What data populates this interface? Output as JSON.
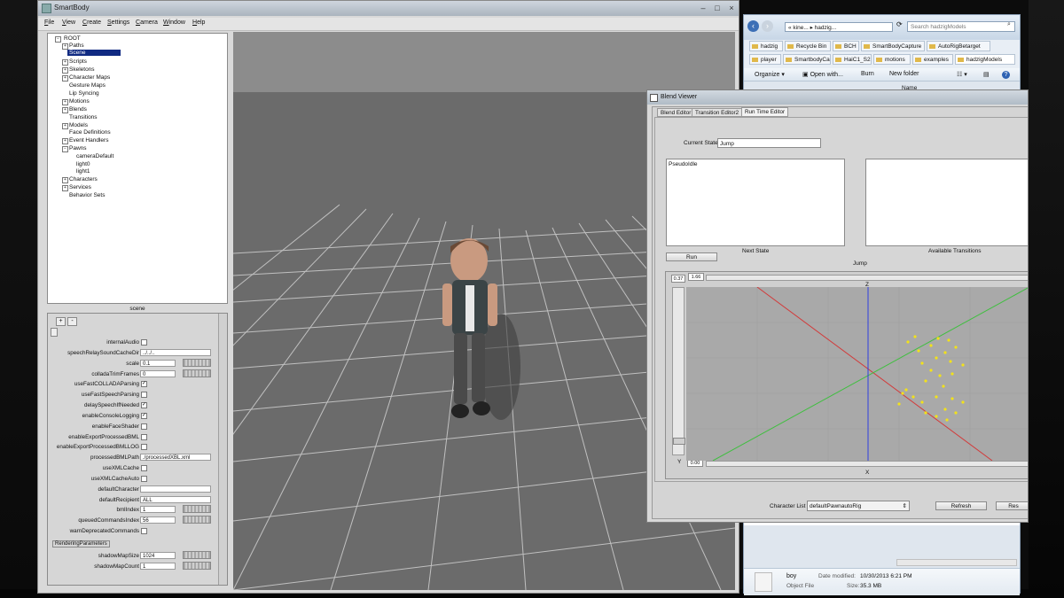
{
  "smartbody": {
    "title": "SmartBody",
    "window_controls": [
      "minimize",
      "maximize",
      "close"
    ],
    "menu": [
      {
        "label": "File",
        "mnemonic": "F",
        "rest": "ile"
      },
      {
        "label": "View",
        "mnemonic": "V",
        "rest": "iew"
      },
      {
        "label": "Create",
        "mnemonic": "C",
        "rest": "reate"
      },
      {
        "label": "Settings",
        "mnemonic": "S",
        "rest": "ettings"
      },
      {
        "label": "Camera",
        "mnemonic": "C",
        "rest": "amera"
      },
      {
        "label": "Window",
        "mnemonic": "W",
        "rest": "indow"
      },
      {
        "label": "Help",
        "mnemonic": "H",
        "rest": "elp"
      }
    ],
    "tree": {
      "root": "ROOT",
      "items": [
        "Paths",
        "Scene",
        "Scripts",
        "Skeletons",
        "Character Maps",
        "Gesture Maps",
        "Lip Syncing",
        "Motions",
        "Blends",
        "Transitions",
        "Models",
        "Face Definitions",
        "Event Handlers",
        "Pawns",
        "cameraDefault",
        "light0",
        "light1",
        "Characters",
        "Services",
        "Behavior Sets"
      ],
      "selected": "Scene"
    },
    "panel_label": "scene",
    "add_label": "+",
    "remove_label": "-",
    "properties": {
      "labels": [
        "internalAudio",
        "speechRelaySoundCacheDir",
        "scale",
        "colladaTrimFrames",
        "useFastCOLLADAParsing",
        "useFastSpeechParsing",
        "delaySpeechIfNeeded",
        "enableConsoleLogging",
        "enableFaceShader",
        "enableExportProcessedBML",
        "enableExportProcessedBMLLOG",
        "processedBMLPath",
        "useXMLCache",
        "useXMLCacheAuto",
        "defaultCharacter",
        "defaultRecipient",
        "bmlIndex",
        "queuedCommandsIndex",
        "warnDeprecatedCommands"
      ],
      "values": {
        "speechRelaySoundCacheDir": "../../..",
        "scale": "0.1",
        "colladaTrimFrames": "0",
        "processedBMLPath": "./processedXBL.xml",
        "defaultCharacter": "",
        "defaultRecipient": "ALL",
        "bmlIndex": "1",
        "queuedCommandsIndex": "56"
      },
      "checked": [
        "useFastCOLLADAParsing",
        "delaySpeechIfNeeded",
        "enableConsoleLogging"
      ],
      "check_mark": "✓",
      "rendering_group": "RenderingParameters",
      "rendering": {
        "labels": [
          "shadowMapSize",
          "shadowMapCount"
        ],
        "values": {
          "shadowMapSize": "1024",
          "shadowMapCount": "1"
        }
      }
    }
  },
  "explorer": {
    "breadcrumb_1": "« kine...",
    "breadcrumb_2": "hadzig...",
    "search_placeholder": "Search hadzigModels",
    "tabs": [
      "hadzig",
      "Recycle Bin",
      "BCH",
      "SmartBodyCapture",
      "AutoRigBetarget",
      "player",
      "SmartbodyCams",
      "HaiC1_S2",
      "motions",
      "examples",
      "hadzigModels"
    ],
    "toolbar": [
      "Organize ▾",
      "Open with...",
      "Burn",
      "New folder"
    ],
    "column_name": "Name",
    "file": {
      "name": "boy",
      "type": "Object File",
      "date_label": "Date modified:",
      "date": "10/30/2013 6:21 PM",
      "size_label": "Size:",
      "size": "35.3 MB"
    }
  },
  "blend_viewer": {
    "title": "Blend Viewer",
    "tabs": [
      "Blend Editor",
      "Transition Editor2",
      "Run Time Editor"
    ],
    "active_tab": "Run Time Editor",
    "current_state_label": "Current State",
    "current_state_value": "Jump",
    "next_state_items": [
      "PseudoIdle"
    ],
    "next_state_label": "Next State",
    "available_transitions_label": "Available Transitions",
    "run_label": "Run",
    "plot_title": "Jump",
    "slider_top_value": "0.37",
    "slider_top_value2": "1.66",
    "slider_bottom_value": "0.00",
    "axis_y": "Y",
    "axis_x": "X",
    "axis_z": "Z",
    "character_list_label": "Character List",
    "character_list_value": "defaultPawnautoRig",
    "refresh_label": "Refresh",
    "reset_label": "Res"
  },
  "colors": {
    "selection": "#102a82",
    "grid": "#d0d0d0",
    "plot_points": "#f2e21a",
    "axis_red": "#d23b3b",
    "axis_green": "#3fbf3f",
    "axis_blue": "#2e3fe0"
  }
}
